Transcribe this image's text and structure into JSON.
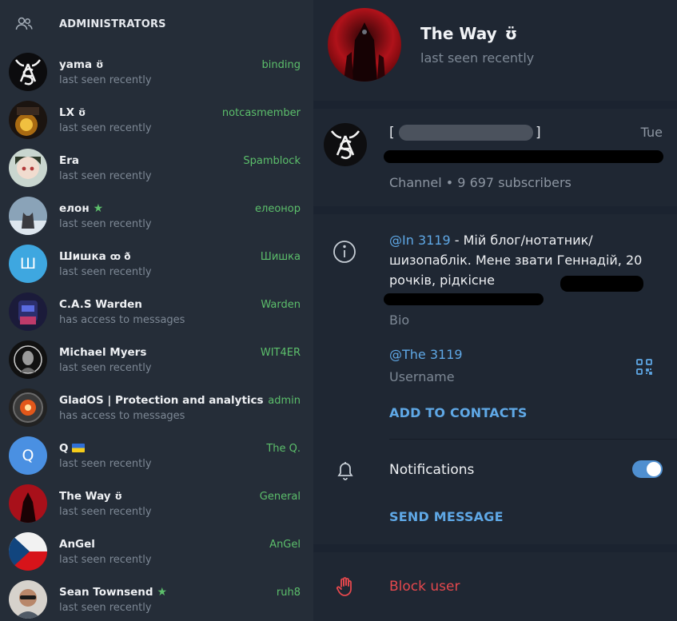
{
  "admins_panel": {
    "title": "ADMINISTRATORS",
    "icon": "users-icon",
    "items": [
      {
        "name": "yama",
        "badge": "ʊ̈",
        "status": "last seen recently",
        "role": "binding",
        "avatar": "cas-logo"
      },
      {
        "name": "LX",
        "badge": "ʊ̈",
        "status": "last seen recently",
        "role": "notcasmember",
        "avatar": "photo-dark"
      },
      {
        "name": "Era",
        "badge": "",
        "status": "last seen recently",
        "role": "Spamblock",
        "avatar": "photo-anime"
      },
      {
        "name": "елон",
        "badge": "★",
        "status": "last seen recently",
        "role": "елеонор",
        "avatar": "photo-cat"
      },
      {
        "name": "Шишка",
        "badge": "ꝏ ð",
        "status": "last seen recently",
        "role": "Шишка",
        "avatar": "letter",
        "letter": "Ш",
        "color": "#3ea7e0"
      },
      {
        "name": "C.A.S Warden",
        "badge": "",
        "status": "has access to messages",
        "role": "Warden",
        "avatar": "photo-robot"
      },
      {
        "name": "Michael Myers",
        "badge": "",
        "status": "last seen recently",
        "role": "WIT4ER",
        "avatar": "photo-mask"
      },
      {
        "name": "GladOS | Protection and analytics",
        "badge": "",
        "status": "has access to messages",
        "role": "admin",
        "avatar": "photo-eye"
      },
      {
        "name": "Q",
        "badge": "flag-ua",
        "status": "last seen recently",
        "role": "The Q.",
        "avatar": "letter",
        "letter": "Q",
        "color": "#4a90e2"
      },
      {
        "name": "The Way",
        "badge": "ʊ̈",
        "status": "last seen recently",
        "role": "General",
        "avatar": "photo-red"
      },
      {
        "name": "AnGel",
        "badge": "",
        "status": "last seen recently",
        "role": "AnGel",
        "avatar": "photo-flag"
      },
      {
        "name": "Sean Townsend",
        "badge": "★",
        "status": "last seen recently",
        "role": "ruh8",
        "avatar": "photo-man"
      }
    ]
  },
  "profile": {
    "name": "The Way",
    "name_badge": "ʊ̈",
    "status": "last seen recently"
  },
  "channel": {
    "title_open": "[",
    "title_close": "]",
    "day": "Tue",
    "subscribers": "Channel • 9 697 subscribers"
  },
  "info": {
    "bio_handle": "@In          3119",
    "bio_text": " - Мій блог/нотатник/шизопаблік. Мене звати Геннадій, 20 рочків, рідкісне",
    "bio_label": "Bio",
    "username": "@The            3119",
    "username_label": "Username",
    "add_contacts": "ADD TO CONTACTS",
    "notifications_label": "Notifications",
    "notifications_on": true,
    "send_message": "SEND MESSAGE"
  },
  "block": {
    "label": "Block user"
  },
  "colors": {
    "accent": "#5fa8e6",
    "role_green": "#5cbf6b",
    "danger": "#e5484d",
    "toggle": "#4f8fd0"
  }
}
